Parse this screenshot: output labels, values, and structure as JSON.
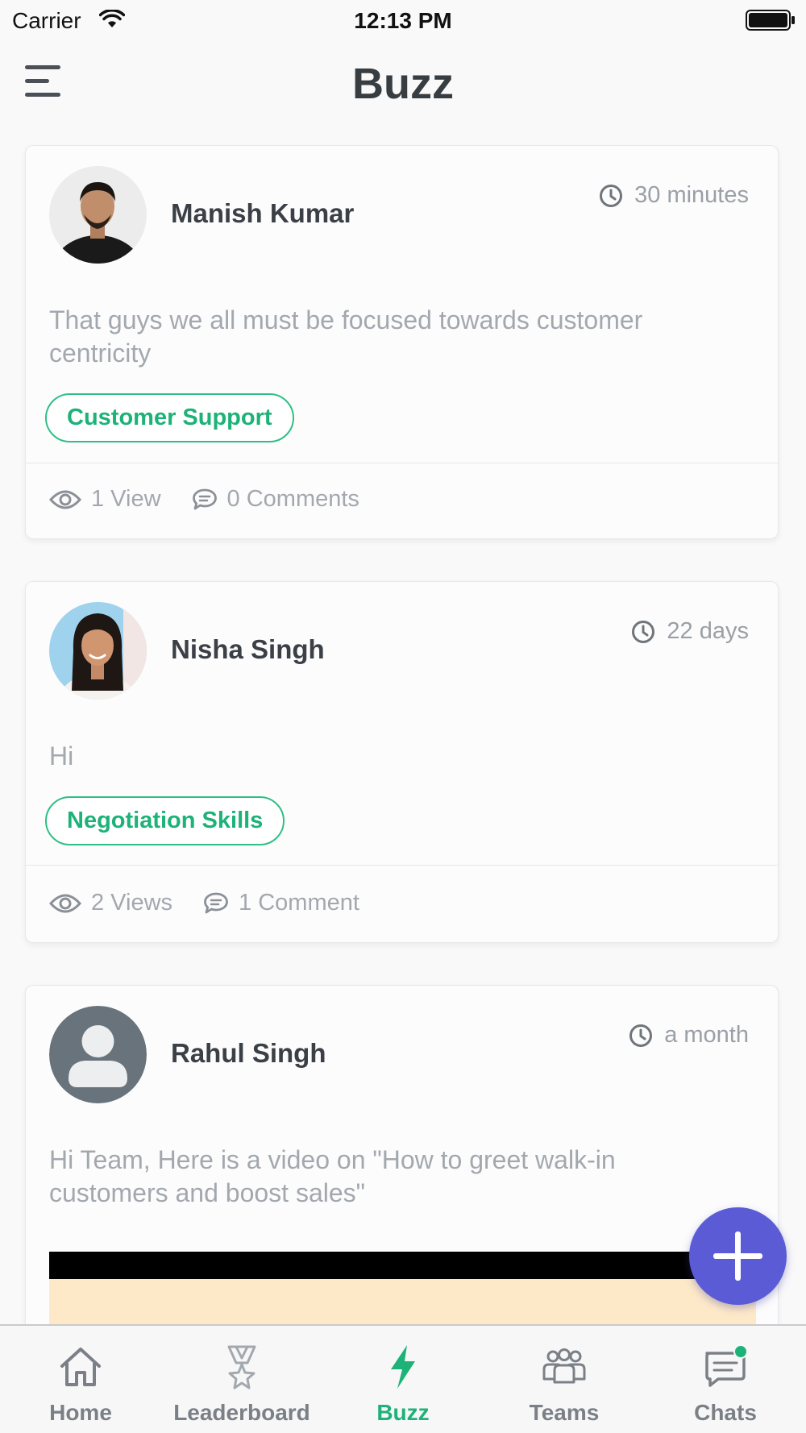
{
  "status_bar": {
    "carrier": "Carrier",
    "time": "12:13 PM"
  },
  "header": {
    "title": "Buzz"
  },
  "posts": [
    {
      "author": "Manish Kumar",
      "time": "30 minutes",
      "text": "That guys we all must be focused towards customer centricity",
      "tag": "Customer Support",
      "views": "1 View",
      "comments": "0 Comments"
    },
    {
      "author": "Nisha Singh",
      "time": "22 days",
      "text": "Hi",
      "tag": "Negotiation Skills",
      "views": "2 Views",
      "comments": "1 Comment"
    },
    {
      "author": "Rahul Singh",
      "time": "a month",
      "text": "Hi Team, Here is a video on \"How to greet walk-in customers and boost sales\""
    }
  ],
  "tabs": [
    {
      "label": "Home",
      "icon": "home-icon"
    },
    {
      "label": "Leaderboard",
      "icon": "trophy-icon"
    },
    {
      "label": "Buzz",
      "icon": "lightning-icon",
      "active": true
    },
    {
      "label": "Teams",
      "icon": "team-icon"
    },
    {
      "label": "Chats",
      "icon": "chat-icon",
      "badge": true
    }
  ],
  "colors": {
    "accent": "#1db278",
    "fab": "#5b5bd6",
    "text_muted": "#a3a8ae"
  }
}
